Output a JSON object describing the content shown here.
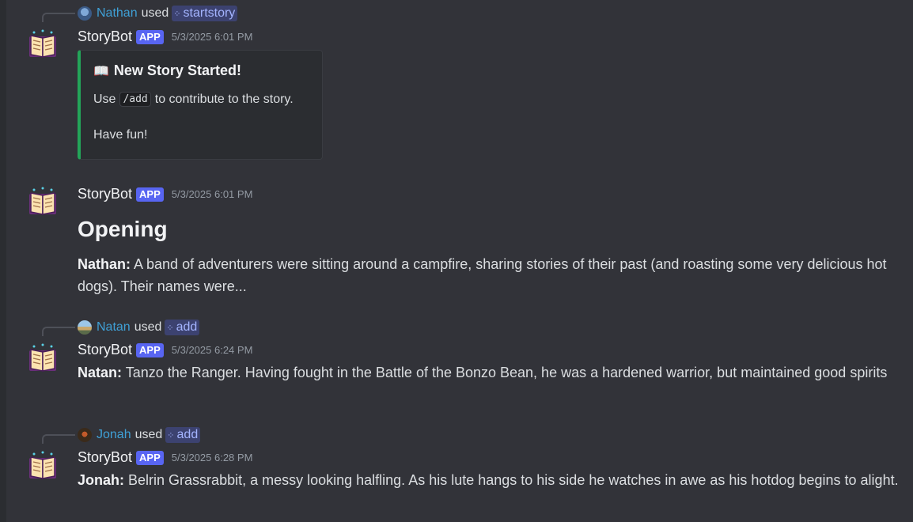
{
  "messages": [
    {
      "reply": {
        "user": "Nathan",
        "used": "used",
        "command": "startstory"
      },
      "author": "StoryBot",
      "badge": "APP",
      "time": "5/3/2025 6:01 PM",
      "embed": {
        "title": "New Story Started!",
        "line1_pre": "Use",
        "code": "/add",
        "line1_post": "to contribute to the story.",
        "line2": "Have fun!",
        "accent": "#23a559"
      }
    },
    {
      "author": "StoryBot",
      "badge": "APP",
      "time": "5/3/2025 6:01 PM",
      "heading": "Opening",
      "speaker": "Nathan:",
      "text": "A band of adventurers were sitting around a campfire, sharing stories of their past (and roasting some very delicious hot dogs). Their names were..."
    },
    {
      "reply": {
        "user": "Natan",
        "used": "used",
        "command": "add"
      },
      "author": "StoryBot",
      "badge": "APP",
      "time": "5/3/2025 6:24 PM",
      "speaker": "Natan:",
      "text": "Tanzo the Ranger. Having fought in the Battle of the Bonzo Bean, he was a hardened warrior, but maintained good spirits"
    },
    {
      "reply": {
        "user": "Jonah",
        "used": "used",
        "command": "add"
      },
      "author": "StoryBot",
      "badge": "APP",
      "time": "5/3/2025 6:28 PM",
      "speaker": "Jonah:",
      "text": "Belrin Grassrabbit, a messy looking halfling. As his lute hangs to his side he watches in awe as his hotdog begins to alight."
    }
  ],
  "colors": {
    "background": "#323339",
    "badge": "#5865f2",
    "link": "#3fa0d6",
    "command_bg": "#3c4270"
  },
  "icons": {
    "bot_avatar": "open-book-icon",
    "command": "slash-command-icon"
  }
}
